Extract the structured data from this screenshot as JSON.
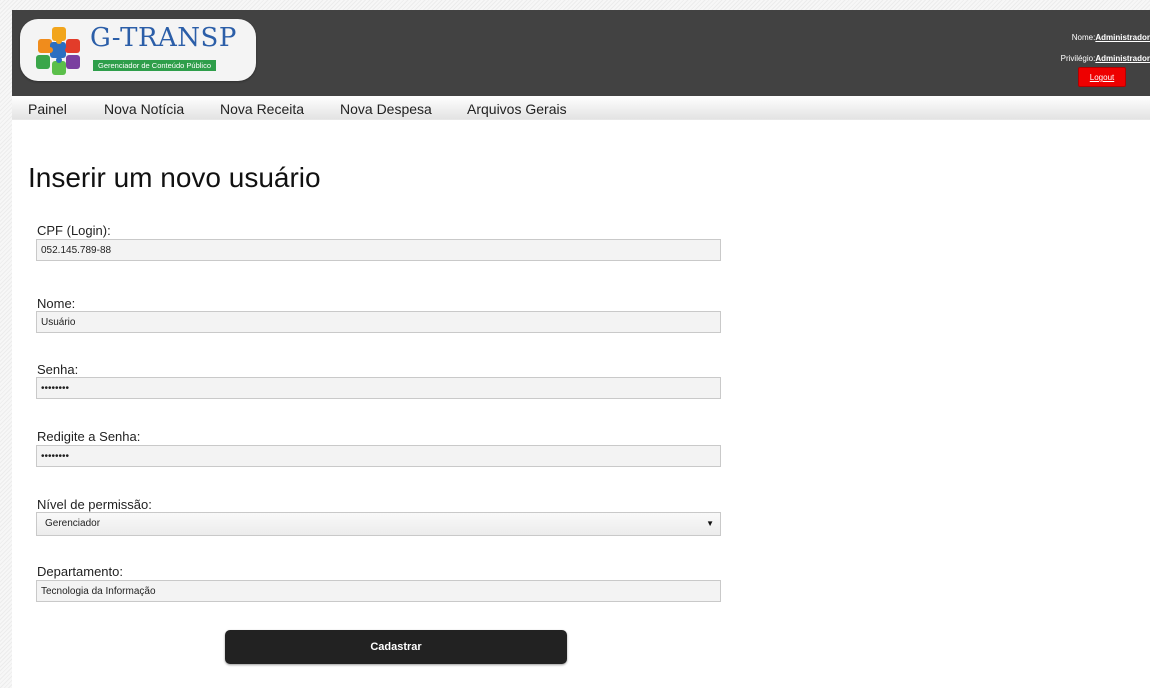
{
  "header": {
    "logo_title": "G-TRANSP",
    "logo_subtitle": "Gerenciador de Conteúdo Público",
    "user_name_label": "Nome:",
    "user_name": "Administrador",
    "privilege_label": "Privilégio:",
    "privilege": "Administrador",
    "logout_label": "Logout"
  },
  "nav": {
    "items": [
      {
        "label": "Painel"
      },
      {
        "label": "Nova Notícia"
      },
      {
        "label": "Nova Receita"
      },
      {
        "label": "Nova Despesa"
      },
      {
        "label": "Arquivos Gerais"
      }
    ]
  },
  "form": {
    "title": "Inserir um novo usuário",
    "cpf_label": "CPF (Login):",
    "cpf_value": "052.145.789-88",
    "name_label": "Nome:",
    "name_value": "Usuário",
    "password_label": "Senha:",
    "password_value": "••••••••",
    "password_confirm_label": "Redigite a Senha:",
    "password_confirm_value": "••••••••",
    "permission_label": "Nível de permissão:",
    "permission_value": "Gerenciador",
    "department_label": "Departamento:",
    "department_value": "Tecnologia da Informação",
    "submit_label": "Cadastrar"
  },
  "colors": {
    "header_bg": "#424242",
    "logout_bg": "#ee0000",
    "button_bg": "#222222",
    "logo_blue": "#2b5ea8",
    "logo_green": "#2e9e4a"
  },
  "icons": {
    "logo": "puzzle-logo-icon",
    "select_arrow": "triangle-down-icon"
  }
}
